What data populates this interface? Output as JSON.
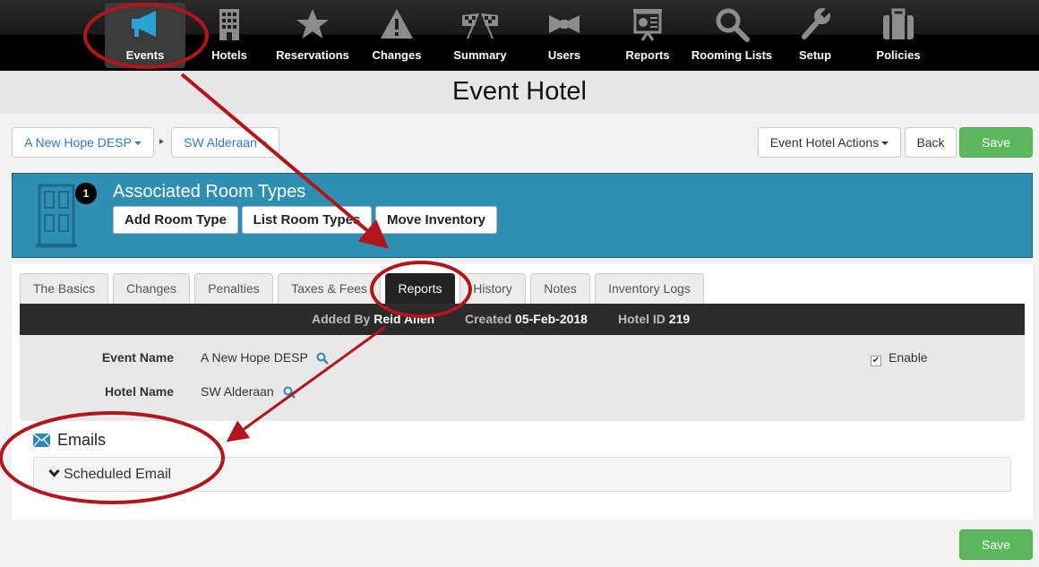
{
  "nav": {
    "items": [
      {
        "label": "Events",
        "icon": "megaphone-icon",
        "active": true
      },
      {
        "label": "Hotels",
        "icon": "building-icon"
      },
      {
        "label": "Reservations",
        "icon": "star-icon"
      },
      {
        "label": "Changes",
        "icon": "warning-icon"
      },
      {
        "label": "Summary",
        "icon": "checkered-flags-icon"
      },
      {
        "label": "Users",
        "icon": "bowtie-icon"
      },
      {
        "label": "Reports",
        "icon": "presentation-icon"
      },
      {
        "label": "Rooming Lists",
        "icon": "magnifier-icon"
      },
      {
        "label": "Setup",
        "icon": "wrench-icon"
      },
      {
        "label": "Policies",
        "icon": "briefcase-icon"
      }
    ]
  },
  "page": {
    "title": "Event Hotel"
  },
  "breadcrumb": {
    "event": "A New Hope DESP",
    "hotel": "SW Alderaan"
  },
  "actions": {
    "menu_label": "Event Hotel Actions",
    "back_label": "Back",
    "save_label": "Save"
  },
  "banner": {
    "badge": "1",
    "title": "Associated Room Types",
    "buttons": [
      "Add Room Type",
      "List Room Types",
      "Move Inventory"
    ]
  },
  "tabs": [
    {
      "label": "The Basics"
    },
    {
      "label": "Changes"
    },
    {
      "label": "Penalties"
    },
    {
      "label": "Taxes & Fees"
    },
    {
      "label": "Reports",
      "active": true
    },
    {
      "label": "History"
    },
    {
      "label": "Notes"
    },
    {
      "label": "Inventory Logs"
    }
  ],
  "info": {
    "added_by_label": "Added By",
    "added_by": "Reid Allen",
    "created_label": "Created",
    "created": "05-Feb-2018",
    "hotel_id_label": "Hotel ID",
    "hotel_id": "219"
  },
  "details": {
    "event_name_label": "Event Name",
    "event_name": "A New Hope DESP",
    "hotel_name_label": "Hotel Name",
    "hotel_name": "SW Alderaan",
    "enable_label": "Enable",
    "enable_checked": true
  },
  "emails": {
    "heading": "Emails",
    "scheduled_label": "Scheduled Email"
  },
  "footer": {
    "save_label": "Save"
  },
  "colors": {
    "accent": "#2f8fb3",
    "save_green": "#5cb85c",
    "annotation_red": "#b0161b",
    "icon_blue": "#29a3d6"
  }
}
